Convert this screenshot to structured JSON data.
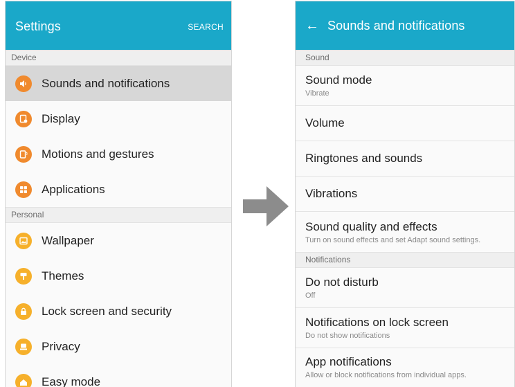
{
  "left": {
    "title": "Settings",
    "search_label": "SEARCH",
    "sections": {
      "device": "Device",
      "personal": "Personal"
    },
    "device_items": [
      {
        "label": "Sounds and notifications",
        "icon": "volume-icon",
        "color": "#f08a2e"
      },
      {
        "label": "Display",
        "icon": "display-icon",
        "color": "#f08a2e"
      },
      {
        "label": "Motions and gestures",
        "icon": "motion-icon",
        "color": "#f08a2e"
      },
      {
        "label": "Applications",
        "icon": "apps-icon",
        "color": "#f08a2e"
      }
    ],
    "personal_items": [
      {
        "label": "Wallpaper",
        "icon": "wallpaper-icon",
        "color": "#f6b02b"
      },
      {
        "label": "Themes",
        "icon": "themes-icon",
        "color": "#f6b02b"
      },
      {
        "label": "Lock screen and security",
        "icon": "lock-icon",
        "color": "#f6b02b"
      },
      {
        "label": "Privacy",
        "icon": "privacy-icon",
        "color": "#f6b02b"
      },
      {
        "label": "Easy mode",
        "icon": "home-icon",
        "color": "#f6b02b"
      }
    ]
  },
  "right": {
    "title": "Sounds and notifications",
    "back_icon": "back-arrow-icon",
    "sections": {
      "sound": "Sound",
      "notifications": "Notifications"
    },
    "sound_items": [
      {
        "label": "Sound mode",
        "sub": "Vibrate"
      },
      {
        "label": "Volume"
      },
      {
        "label": "Ringtones and sounds"
      },
      {
        "label": "Vibrations"
      },
      {
        "label": "Sound quality and effects",
        "sub": "Turn on sound effects and set Adapt sound settings."
      }
    ],
    "notification_items": [
      {
        "label": "Do not disturb",
        "sub": "Off"
      },
      {
        "label": "Notifications on lock screen",
        "sub": "Do not show notifications"
      },
      {
        "label": "App notifications",
        "sub": "Allow or block notifications from individual apps."
      }
    ]
  },
  "colors": {
    "appbar": "#1aa8c9",
    "selected_row": "#d7d7d7",
    "arrow": "#8c8c8c"
  }
}
